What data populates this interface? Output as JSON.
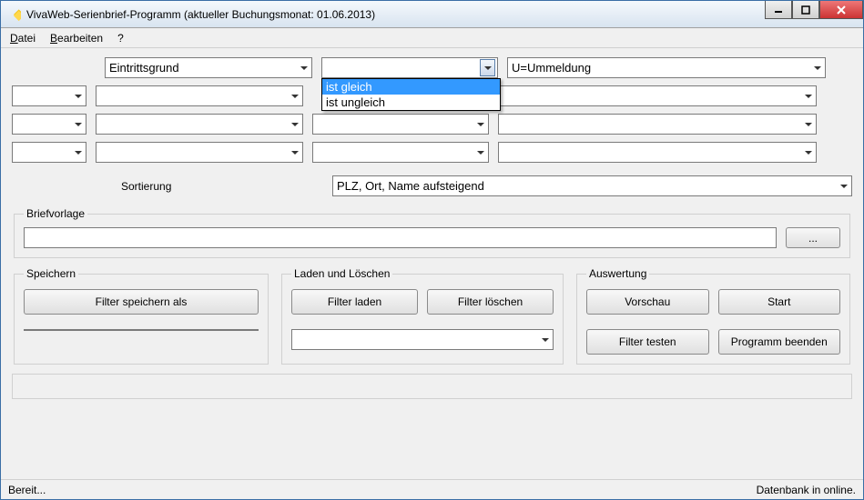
{
  "window": {
    "title": "VivaWeb-Serienbrief-Programm (aktueller Buchungsmonat: 01.06.2013)"
  },
  "menu": {
    "datei": "Datei",
    "bearbeiten": "Bearbeiten",
    "help": "?"
  },
  "filters": {
    "row0": {
      "field": "Eintrittsgrund",
      "operator": "",
      "value": "U=Ummeldung"
    },
    "operator_dropdown": {
      "options": [
        "ist gleich",
        "ist ungleich"
      ],
      "selected_index": 0
    }
  },
  "sort": {
    "label": "Sortierung",
    "value": "PLZ, Ort, Name aufsteigend"
  },
  "brief": {
    "legend": "Briefvorlage",
    "path": "",
    "browse": "..."
  },
  "groups": {
    "save": {
      "legend": "Speichern",
      "save_as": "Filter speichern als"
    },
    "load": {
      "legend": "Laden und Löschen",
      "load": "Filter laden",
      "delete": "Filter löschen"
    },
    "eval": {
      "legend": "Auswertung",
      "preview": "Vorschau",
      "start": "Start",
      "test": "Filter testen",
      "exit": "Programm beenden"
    }
  },
  "status": {
    "left": "Bereit...",
    "right": "Datenbank in online."
  }
}
